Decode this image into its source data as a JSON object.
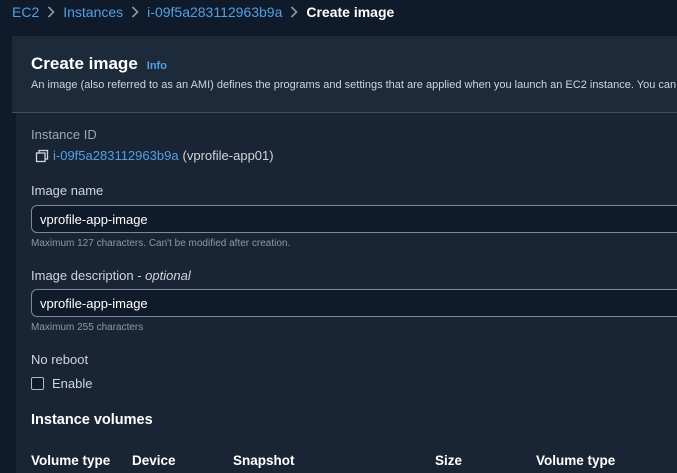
{
  "breadcrumb": {
    "items": [
      "EC2",
      "Instances",
      "i-09f5a283112963b9a"
    ],
    "current": "Create image"
  },
  "header": {
    "title": "Create image",
    "info": "Info",
    "description": "An image (also referred to as an AMI) defines the programs and settings that are applied when you launch an EC2 instance. You can c"
  },
  "instance": {
    "label": "Instance ID",
    "id": "i-09f5a283112963b9a",
    "name": "(vprofile-app01)"
  },
  "image_name": {
    "label": "Image name",
    "value": "vprofile-app-image",
    "hint": "Maximum 127 characters. Can't be modified after creation."
  },
  "image_description": {
    "label": "Image description - ",
    "label_optional": "optional",
    "value": "vprofile-app-image",
    "hint": "Maximum 255 characters"
  },
  "no_reboot": {
    "label": "No reboot",
    "checkbox_label": "Enable",
    "checked": false
  },
  "volumes": {
    "title": "Instance volumes",
    "columns": [
      "Volume type",
      "Device",
      "Snapshot",
      "Size",
      "Volume type"
    ]
  },
  "colors": {
    "link": "#539fe5",
    "background": "#0f1b2a",
    "panel": "#192534"
  }
}
